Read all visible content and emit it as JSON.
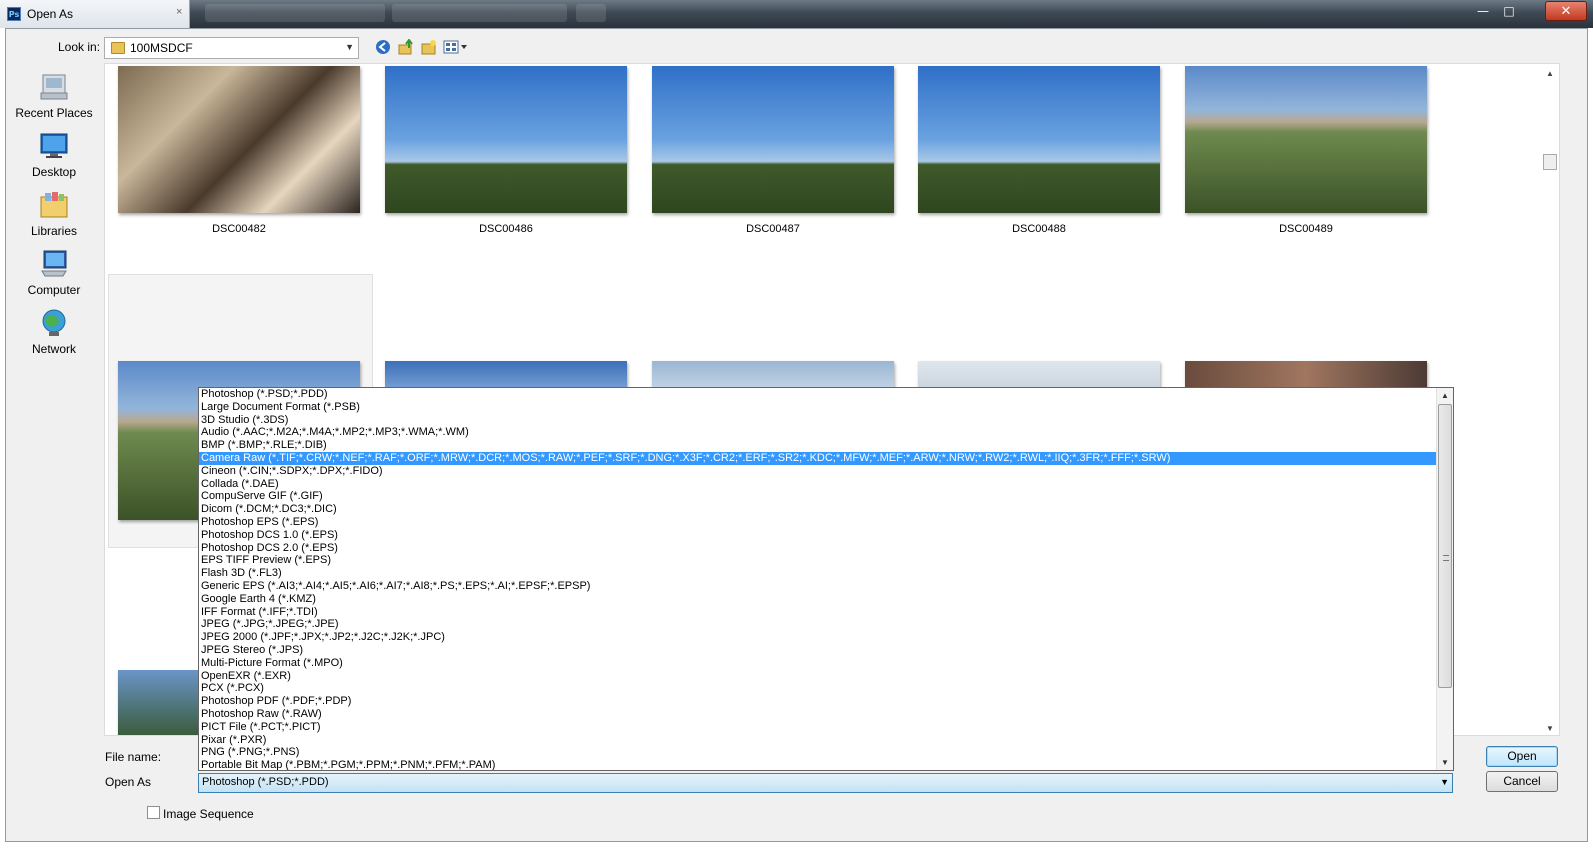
{
  "window": {
    "title": "Open As",
    "close_glyph": "✕",
    "minimize_glyph": "—",
    "maximize_glyph": "□"
  },
  "toolbar": {
    "look_in_label": "Look in:",
    "look_in_value": "100MSDCF",
    "back_icon": "back-arrow-icon",
    "up_icon": "up-folder-icon",
    "new_folder_icon": "new-folder-icon",
    "view_menu_icon": "view-menu-icon"
  },
  "places": [
    {
      "label": "Recent Places",
      "icon": "recent-places-icon"
    },
    {
      "label": "Desktop",
      "icon": "desktop-icon"
    },
    {
      "label": "Libraries",
      "icon": "libraries-icon"
    },
    {
      "label": "Computer",
      "icon": "computer-icon"
    },
    {
      "label": "Network",
      "icon": "network-icon"
    }
  ],
  "files": [
    {
      "name": "DSC00482"
    },
    {
      "name": "DSC00486"
    },
    {
      "name": "DSC00487"
    },
    {
      "name": "DSC00488"
    },
    {
      "name": "DSC00489"
    }
  ],
  "format_list": {
    "selected_index": 5,
    "items": [
      "Photoshop (*.PSD;*.PDD)",
      "Large Document Format (*.PSB)",
      "3D Studio (*.3DS)",
      "Audio (*.AAC;*.M2A;*.M4A;*.MP2;*.MP3;*.WMA;*.WM)",
      "BMP (*.BMP;*.RLE;*.DIB)",
      "Camera Raw (*.TIF;*.CRW;*.NEF;*.RAF;*.ORF;*.MRW;*.DCR;*.MOS;*.RAW;*.PEF;*.SRF;*.DNG;*.X3F;*.CR2;*.ERF;*.SR2;*.KDC;*.MFW;*.MEF;*.ARW;*.NRW;*.RW2;*.RWL;*.IIQ;*.3FR;*.FFF;*.SRW)",
      "Cineon (*.CIN;*.SDPX;*.DPX;*.FIDO)",
      "Collada (*.DAE)",
      "CompuServe GIF (*.GIF)",
      "Dicom (*.DCM;*.DC3;*.DIC)",
      "Photoshop EPS (*.EPS)",
      "Photoshop DCS 1.0 (*.EPS)",
      "Photoshop DCS 2.0 (*.EPS)",
      "EPS TIFF Preview (*.EPS)",
      "Flash 3D (*.FL3)",
      "Generic EPS (*.AI3;*.AI4;*.AI5;*.AI6;*.AI7;*.AI8;*.PS;*.EPS;*.AI;*.EPSF;*.EPSP)",
      "Google Earth 4 (*.KMZ)",
      "IFF Format (*.IFF;*.TDI)",
      "JPEG (*.JPG;*.JPEG;*.JPE)",
      "JPEG 2000 (*.JPF;*.JPX;*.JP2;*.J2C;*.J2K;*.JPC)",
      "JPEG Stereo (*.JPS)",
      "Multi-Picture Format (*.MPO)",
      "OpenEXR (*.EXR)",
      "PCX (*.PCX)",
      "Photoshop PDF (*.PDF;*.PDP)",
      "Photoshop Raw (*.RAW)",
      "PICT File (*.PCT;*.PICT)",
      "Pixar (*.PXR)",
      "PNG (*.PNG;*.PNS)",
      "Portable Bit Map (*.PBM;*.PGM;*.PPM;*.PNM;*.PFM;*.PAM)"
    ]
  },
  "form": {
    "file_name_label": "File name:",
    "open_as_label": "Open As",
    "open_as_value": "Photoshop (*.PSD;*.PDD)",
    "image_sequence_label": "Image Sequence",
    "image_sequence_checked": false
  },
  "buttons": {
    "open": "Open",
    "cancel": "Cancel"
  },
  "colors": {
    "selection": "#3399ff",
    "default_button_border": "#3c7fb1"
  }
}
